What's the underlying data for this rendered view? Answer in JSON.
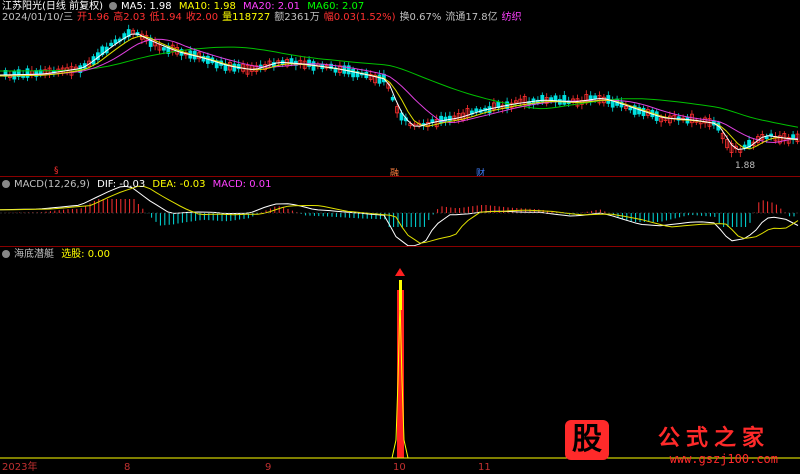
{
  "header1": {
    "stock_name": "江苏阳光(日线 前复权)",
    "ma5": "MA5: 1.98",
    "ma10": "MA10: 1.98",
    "ma20": "MA20: 2.01",
    "ma60": "MA60: 2.07"
  },
  "info_line": {
    "date": "2024/01/10/三",
    "open": "开1.96",
    "high": "高2.03",
    "low": "低1.94",
    "close": "收2.00",
    "volume": "量118727",
    "amount": "额2361万",
    "change": "幅0.03(1.52%)",
    "turnover": "换0.67%",
    "float": "流通17.8亿",
    "industry": "纺织"
  },
  "price_panel": {
    "low_label": "1.88",
    "event_markers": [
      "§",
      "融",
      "财"
    ]
  },
  "macd_header": {
    "title": "MACD(12,26,9)",
    "dif": "DIF: -0.03",
    "dea": "DEA: -0.03",
    "macd": "MACD: 0.01"
  },
  "indicator_header": {
    "title": "海底潜艇",
    "select_label": "选股: 0.00"
  },
  "x_axis": {
    "labels": [
      "2023年",
      "8",
      "9",
      "10",
      "11"
    ]
  },
  "watermark": {
    "logo_char": "股",
    "site_name": "公式之家",
    "url": "www.gszj100.com"
  },
  "colors": {
    "ma5": "#ffffff",
    "ma10": "#ffff00",
    "ma20": "#ff40ff",
    "ma60": "#00ff00",
    "up": "#ff3030",
    "down": "#00e0e0"
  }
}
